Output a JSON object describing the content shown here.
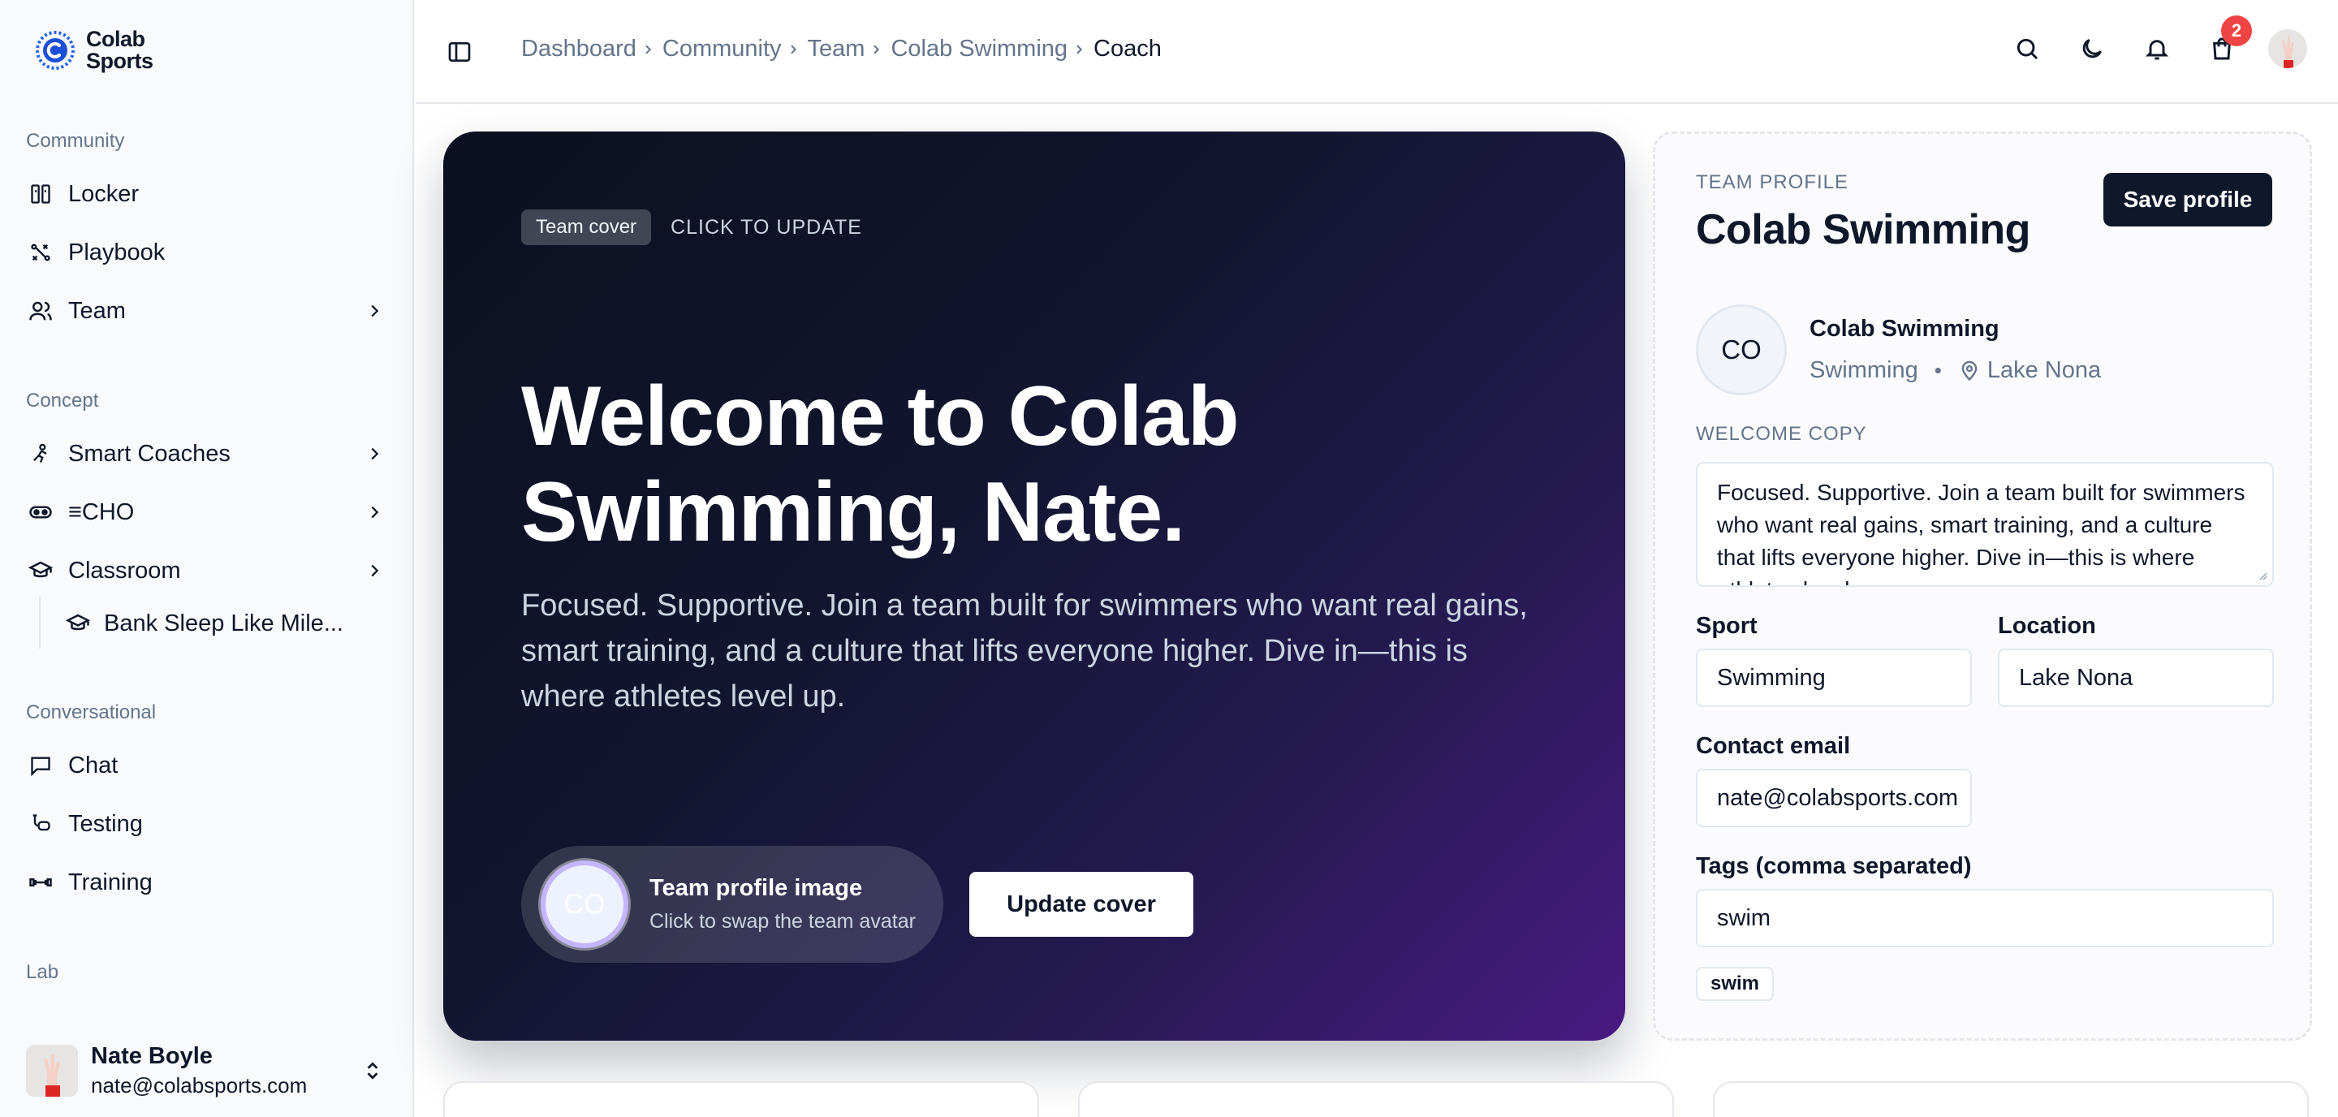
{
  "brand": {
    "line1": "Colab",
    "line2": "Sports"
  },
  "sidebar": {
    "groups": {
      "community": "Community",
      "concept": "Concept",
      "conversational": "Conversational",
      "lab": "Lab"
    },
    "items": {
      "locker": "Locker",
      "playbook": "Playbook",
      "team": "Team",
      "smart_coaches": "Smart Coaches",
      "echo": "≡CHO",
      "classroom": "Classroom",
      "classroom_sub": "Bank Sleep Like Mile...",
      "chat": "Chat",
      "testing": "Testing",
      "training": "Training"
    },
    "user": {
      "name": "Nate Boyle",
      "email": "nate@colabsports.com"
    }
  },
  "breadcrumb": {
    "items": [
      "Dashboard",
      "Community",
      "Team",
      "Colab Swimming"
    ],
    "current": "Coach"
  },
  "topbar": {
    "cart_count": "2"
  },
  "hero": {
    "cover_pill": "Team cover",
    "cover_hint": "CLICK TO UPDATE",
    "title": "Welcome to Colab Swimming, Nate.",
    "body": "Focused. Supportive. Join a team built for swimmers who want real gains, smart training, and a culture that lifts everyone higher. Dive in—this is where athletes level up.",
    "avatar_initials": "CO",
    "profile_image_title": "Team profile image",
    "profile_image_sub": "Click to swap the team avatar",
    "update_cover_label": "Update cover"
  },
  "profile": {
    "kicker": "TEAM PROFILE",
    "title": "Colab Swimming",
    "save_label": "Save profile",
    "avatar_initials": "CO",
    "team_name": "Colab Swimming",
    "sport_meta": "Swimming",
    "location_meta": "Lake Nona",
    "welcome_label": "WELCOME COPY",
    "welcome_text": "Focused. Supportive. Join a team built for swimmers who want real gains, smart training, and a culture that lifts everyone higher. Dive in—this is where athletes level up.",
    "sport_label": "Sport",
    "sport_value": "Swimming",
    "location_label": "Location",
    "location_value": "Lake Nona",
    "email_label": "Contact email",
    "email_value": "nate@colabsports.com",
    "tags_label": "Tags (comma separated)",
    "tags_value": "swim",
    "tag_chip": "swim"
  },
  "colors": {
    "primary": "#0f172a",
    "muted": "#64748b",
    "badge": "#ef4444",
    "hero_start": "#0b1020",
    "hero_end": "#4a1a83"
  }
}
